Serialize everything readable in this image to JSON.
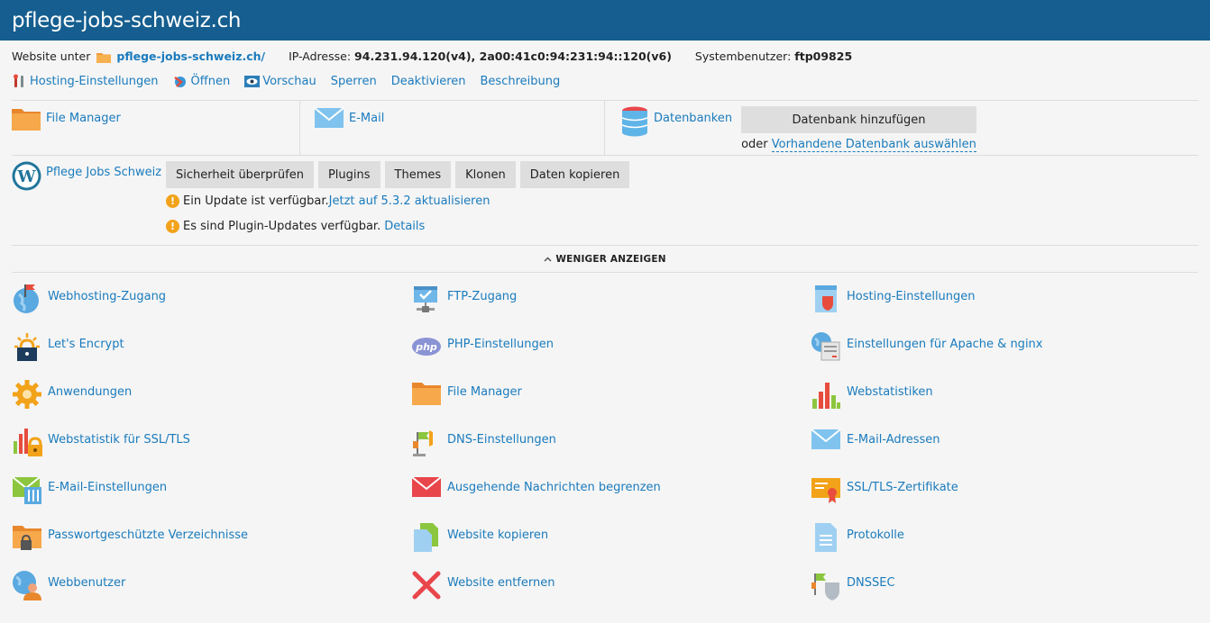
{
  "header": {
    "title": "pflege-jobs-schweiz.ch"
  },
  "info": {
    "website_prefix": "Website unter",
    "website_link": "pflege-jobs-schweiz.ch/",
    "ip_label": "IP-Adresse:",
    "ip_value": "94.231.94.120(v4), 2a00:41c0:94:231:94::120(v6)",
    "sysuser_label": "Systembenutzer:",
    "sysuser_value": "ftp09825"
  },
  "actions": {
    "hosting": "Hosting-Einstellungen",
    "open": "Öffnen",
    "preview": "Vorschau",
    "lock": "Sperren",
    "deactivate": "Deaktivieren",
    "description": "Beschreibung"
  },
  "tiles": {
    "file_manager": "File Manager",
    "email": "E-Mail",
    "databases": "Datenbanken",
    "add_db": "Datenbank hinzufügen",
    "or": "oder",
    "choose_db": "Vorhandene Datenbank auswählen"
  },
  "wordpress": {
    "name": "Pflege Jobs Schweiz",
    "buttons": [
      "Sicherheit überprüfen",
      "Plugins",
      "Themes",
      "Klonen",
      "Daten kopieren"
    ],
    "update_text": "Ein Update ist verfügbar.",
    "update_link": "Jetzt auf 5.3.2 aktualisieren",
    "plugin_text": "Es sind Plugin-Updates verfügbar.",
    "plugin_link": "Details"
  },
  "toggle": {
    "label": "WENIGER ANZEIGEN"
  },
  "grid": [
    {
      "label": "Webhosting-Zugang",
      "icon": "globe-flag-icon"
    },
    {
      "label": "FTP-Zugang",
      "icon": "ftp-icon"
    },
    {
      "label": "Hosting-Einstellungen",
      "icon": "hosting-settings-icon"
    },
    {
      "label": "Let's Encrypt",
      "icon": "lets-encrypt-icon"
    },
    {
      "label": "PHP-Einstellungen",
      "icon": "php-icon"
    },
    {
      "label": "Einstellungen für Apache & nginx",
      "icon": "apache-nginx-icon"
    },
    {
      "label": "Anwendungen",
      "icon": "gear-icon"
    },
    {
      "label": "File Manager",
      "icon": "folder-icon"
    },
    {
      "label": "Webstatistiken",
      "icon": "bar-chart-icon"
    },
    {
      "label": "Webstatistik für SSL/TLS",
      "icon": "ssl-stats-icon"
    },
    {
      "label": "DNS-Einstellungen",
      "icon": "dns-icon"
    },
    {
      "label": "E-Mail-Adressen",
      "icon": "envelope-icon"
    },
    {
      "label": "E-Mail-Einstellungen",
      "icon": "email-settings-icon"
    },
    {
      "label": "Ausgehende Nachrichten begrenzen",
      "icon": "outgoing-mail-icon"
    },
    {
      "label": "SSL/TLS-Zertifikate",
      "icon": "certificate-icon"
    },
    {
      "label": "Passwortgeschützte Verzeichnisse",
      "icon": "locked-folder-icon"
    },
    {
      "label": "Website kopieren",
      "icon": "copy-icon"
    },
    {
      "label": "Protokolle",
      "icon": "log-icon"
    },
    {
      "label": "Webbenutzer",
      "icon": "web-user-icon"
    },
    {
      "label": "Website entfernen",
      "icon": "remove-icon"
    },
    {
      "label": "DNSSEC",
      "icon": "dnssec-icon"
    }
  ],
  "colors": {
    "header_bg": "#155e8f",
    "link": "#1a7bbd",
    "button_bg": "#dedede",
    "warning": "#f2a31a"
  }
}
